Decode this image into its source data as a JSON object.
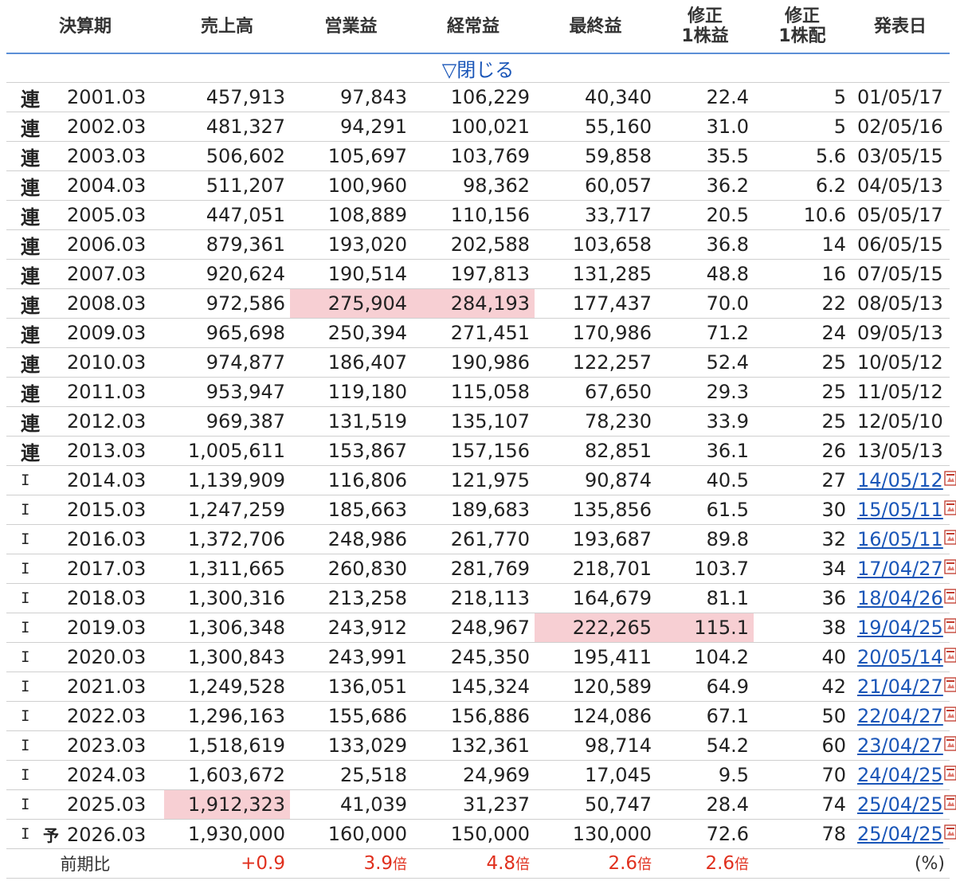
{
  "headers": {
    "period": "決算期",
    "sales": "売上高",
    "operating": "営業益",
    "ordinary": "経常益",
    "net": "最終益",
    "eps_line1": "修正",
    "eps_line2": "1株益",
    "div_line1": "修正",
    "div_line2": "1株配",
    "date": "発表日"
  },
  "toggle_label": "▽閉じる",
  "rows": [
    {
      "kind": "連",
      "forecast": "",
      "period": "2001.03",
      "sales": "457,913",
      "operating": "97,843",
      "ordinary": "106,229",
      "net": "40,340",
      "eps": "22.4",
      "div": "5",
      "date": "01/05/17",
      "link": false
    },
    {
      "kind": "連",
      "forecast": "",
      "period": "2002.03",
      "sales": "481,327",
      "operating": "94,291",
      "ordinary": "100,021",
      "net": "55,160",
      "eps": "31.0",
      "div": "5",
      "date": "02/05/16",
      "link": false
    },
    {
      "kind": "連",
      "forecast": "",
      "period": "2003.03",
      "sales": "506,602",
      "operating": "105,697",
      "ordinary": "103,769",
      "net": "59,858",
      "eps": "35.5",
      "div": "5.6",
      "date": "03/05/15",
      "link": false
    },
    {
      "kind": "連",
      "forecast": "",
      "period": "2004.03",
      "sales": "511,207",
      "operating": "100,960",
      "ordinary": "98,362",
      "net": "60,057",
      "eps": "36.2",
      "div": "6.2",
      "date": "04/05/13",
      "link": false
    },
    {
      "kind": "連",
      "forecast": "",
      "period": "2005.03",
      "sales": "447,051",
      "operating": "108,889",
      "ordinary": "110,156",
      "net": "33,717",
      "eps": "20.5",
      "div": "10.6",
      "date": "05/05/17",
      "link": false
    },
    {
      "kind": "連",
      "forecast": "",
      "period": "2006.03",
      "sales": "879,361",
      "operating": "193,020",
      "ordinary": "202,588",
      "net": "103,658",
      "eps": "36.8",
      "div": "14",
      "date": "06/05/15",
      "link": false
    },
    {
      "kind": "連",
      "forecast": "",
      "period": "2007.03",
      "sales": "920,624",
      "operating": "190,514",
      "ordinary": "197,813",
      "net": "131,285",
      "eps": "48.8",
      "div": "16",
      "date": "07/05/15",
      "link": false
    },
    {
      "kind": "連",
      "forecast": "",
      "period": "2008.03",
      "sales": "972,586",
      "operating": "275,904",
      "ordinary": "284,193",
      "net": "177,437",
      "eps": "70.0",
      "div": "22",
      "date": "08/05/13",
      "link": false,
      "hl": [
        "operating",
        "ordinary"
      ]
    },
    {
      "kind": "連",
      "forecast": "",
      "period": "2009.03",
      "sales": "965,698",
      "operating": "250,394",
      "ordinary": "271,451",
      "net": "170,986",
      "eps": "71.2",
      "div": "24",
      "date": "09/05/13",
      "link": false
    },
    {
      "kind": "連",
      "forecast": "",
      "period": "2010.03",
      "sales": "974,877",
      "operating": "186,407",
      "ordinary": "190,986",
      "net": "122,257",
      "eps": "52.4",
      "div": "25",
      "date": "10/05/12",
      "link": false
    },
    {
      "kind": "連",
      "forecast": "",
      "period": "2011.03",
      "sales": "953,947",
      "operating": "119,180",
      "ordinary": "115,058",
      "net": "67,650",
      "eps": "29.3",
      "div": "25",
      "date": "11/05/12",
      "link": false
    },
    {
      "kind": "連",
      "forecast": "",
      "period": "2012.03",
      "sales": "969,387",
      "operating": "131,519",
      "ordinary": "135,107",
      "net": "78,230",
      "eps": "33.9",
      "div": "25",
      "date": "12/05/10",
      "link": false
    },
    {
      "kind": "連",
      "forecast": "",
      "period": "2013.03",
      "sales": "1,005,611",
      "operating": "153,867",
      "ordinary": "157,156",
      "net": "82,851",
      "eps": "36.1",
      "div": "26",
      "date": "13/05/13",
      "link": false
    },
    {
      "kind": "I",
      "forecast": "",
      "period": "2014.03",
      "sales": "1,139,909",
      "operating": "116,806",
      "ordinary": "121,975",
      "net": "90,874",
      "eps": "40.5",
      "div": "27",
      "date": "14/05/12",
      "link": true
    },
    {
      "kind": "I",
      "forecast": "",
      "period": "2015.03",
      "sales": "1,247,259",
      "operating": "185,663",
      "ordinary": "189,683",
      "net": "135,856",
      "eps": "61.5",
      "div": "30",
      "date": "15/05/11",
      "link": true
    },
    {
      "kind": "I",
      "forecast": "",
      "period": "2016.03",
      "sales": "1,372,706",
      "operating": "248,986",
      "ordinary": "261,770",
      "net": "193,687",
      "eps": "89.8",
      "div": "32",
      "date": "16/05/11",
      "link": true
    },
    {
      "kind": "I",
      "forecast": "",
      "period": "2017.03",
      "sales": "1,311,665",
      "operating": "260,830",
      "ordinary": "281,769",
      "net": "218,701",
      "eps": "103.7",
      "div": "34",
      "date": "17/04/27",
      "link": true
    },
    {
      "kind": "I",
      "forecast": "",
      "period": "2018.03",
      "sales": "1,300,316",
      "operating": "213,258",
      "ordinary": "218,113",
      "net": "164,679",
      "eps": "81.1",
      "div": "36",
      "date": "18/04/26",
      "link": true
    },
    {
      "kind": "I",
      "forecast": "",
      "period": "2019.03",
      "sales": "1,306,348",
      "operating": "243,912",
      "ordinary": "248,967",
      "net": "222,265",
      "eps": "115.1",
      "div": "38",
      "date": "19/04/25",
      "link": true,
      "hl": [
        "net",
        "eps"
      ]
    },
    {
      "kind": "I",
      "forecast": "",
      "period": "2020.03",
      "sales": "1,300,843",
      "operating": "243,991",
      "ordinary": "245,350",
      "net": "195,411",
      "eps": "104.2",
      "div": "40",
      "date": "20/05/14",
      "link": true
    },
    {
      "kind": "I",
      "forecast": "",
      "period": "2021.03",
      "sales": "1,249,528",
      "operating": "136,051",
      "ordinary": "145,324",
      "net": "120,589",
      "eps": "64.9",
      "div": "42",
      "date": "21/04/27",
      "link": true
    },
    {
      "kind": "I",
      "forecast": "",
      "period": "2022.03",
      "sales": "1,296,163",
      "operating": "155,686",
      "ordinary": "156,886",
      "net": "124,086",
      "eps": "67.1",
      "div": "50",
      "date": "22/04/27",
      "link": true
    },
    {
      "kind": "I",
      "forecast": "",
      "period": "2023.03",
      "sales": "1,518,619",
      "operating": "133,029",
      "ordinary": "132,361",
      "net": "98,714",
      "eps": "54.2",
      "div": "60",
      "date": "23/04/27",
      "link": true
    },
    {
      "kind": "I",
      "forecast": "",
      "period": "2024.03",
      "sales": "1,603,672",
      "operating": "25,518",
      "ordinary": "24,969",
      "net": "17,045",
      "eps": "9.5",
      "div": "70",
      "date": "24/04/25",
      "link": true
    },
    {
      "kind": "I",
      "forecast": "",
      "period": "2025.03",
      "sales": "1,912,323",
      "operating": "41,039",
      "ordinary": "31,237",
      "net": "50,747",
      "eps": "28.4",
      "div": "74",
      "date": "25/04/25",
      "link": true,
      "hl": [
        "sales"
      ]
    },
    {
      "kind": "I",
      "forecast": "予",
      "period": "2026.03",
      "sales": "1,930,000",
      "operating": "160,000",
      "ordinary": "150,000",
      "net": "130,000",
      "eps": "72.6",
      "div": "78",
      "date": "25/04/25",
      "link": true
    }
  ],
  "ratio_row": {
    "label": "前期比",
    "sales": "+0.9",
    "operating_value": "3.9",
    "operating_unit": "倍",
    "ordinary_value": "4.8",
    "ordinary_unit": "倍",
    "net_value": "2.6",
    "net_unit": "倍",
    "eps_value": "2.6",
    "eps_unit": "倍",
    "pct_label": "(%)"
  },
  "colors": {
    "highlight": "#f7cfd3",
    "link": "#1a56b8",
    "ratio_red": "#e0301e",
    "header_rule": "#5b8fd6"
  },
  "icons": {
    "pdf": "pdf-icon"
  }
}
